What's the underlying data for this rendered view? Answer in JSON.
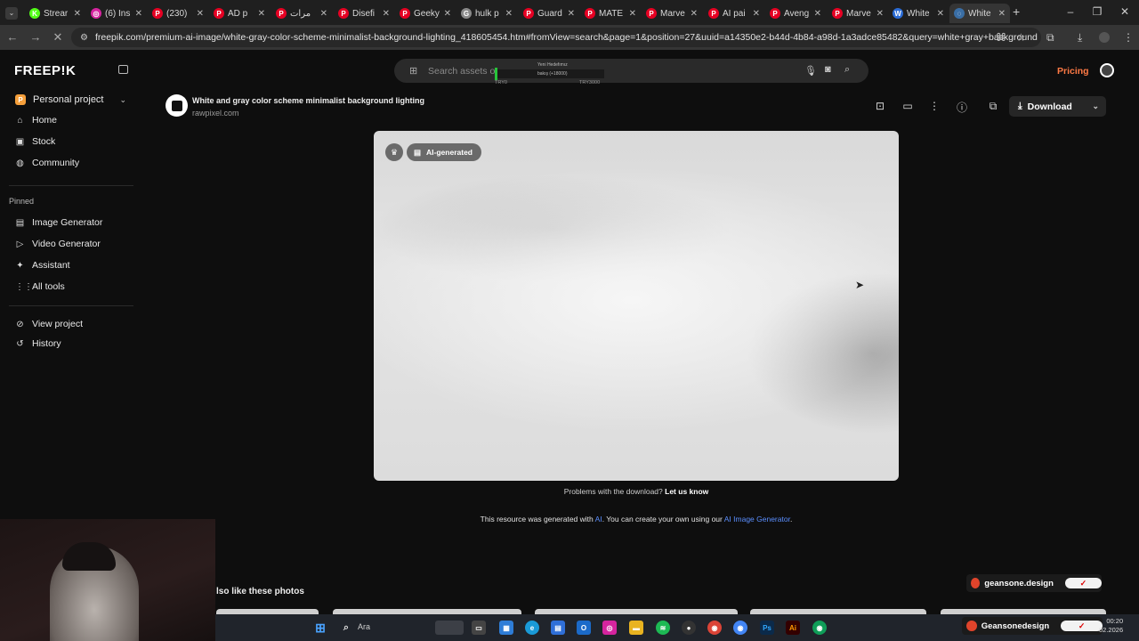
{
  "browser": {
    "tabs": [
      {
        "label": "Strear",
        "icon": "kick-icon",
        "color": "#53fc18",
        "glyph": "K"
      },
      {
        "label": "(6) Ins",
        "icon": "instagram-icon",
        "color": "#d6249f",
        "glyph": "◎"
      },
      {
        "label": "(230)",
        "icon": "pinterest-icon",
        "color": "#e60023",
        "glyph": "P"
      },
      {
        "label": "AD p",
        "icon": "pinterest-icon",
        "color": "#e60023",
        "glyph": "P"
      },
      {
        "label": "مرات",
        "icon": "pinterest-icon",
        "color": "#e60023",
        "glyph": "P"
      },
      {
        "label": "Disefi",
        "icon": "pinterest-icon",
        "color": "#e60023",
        "glyph": "P"
      },
      {
        "label": "Geeky",
        "icon": "pinterest-icon",
        "color": "#e60023",
        "glyph": "P"
      },
      {
        "label": "hulk p",
        "icon": "google-icon",
        "color": "#8a8a8a",
        "glyph": "G"
      },
      {
        "label": "Guard",
        "icon": "pinterest-icon",
        "color": "#e60023",
        "glyph": "P"
      },
      {
        "label": "MATE",
        "icon": "pinterest-icon",
        "color": "#e60023",
        "glyph": "P"
      },
      {
        "label": "Marve",
        "icon": "pinterest-icon",
        "color": "#e60023",
        "glyph": "P"
      },
      {
        "label": "AI pai",
        "icon": "pinterest-icon",
        "color": "#e60023",
        "glyph": "P"
      },
      {
        "label": "Aveng",
        "icon": "pinterest-icon",
        "color": "#e60023",
        "glyph": "P"
      },
      {
        "label": "Marve",
        "icon": "pinterest-icon",
        "color": "#e60023",
        "glyph": "P"
      },
      {
        "label": "White",
        "icon": "word-icon",
        "color": "#2b6cd6",
        "glyph": "W"
      },
      {
        "label": "White",
        "icon": "loading-icon",
        "color": "#3a6ea5",
        "glyph": "◌",
        "active": true
      }
    ],
    "new_tab": "+",
    "url": "freepik.com/premium-ai-image/white-gray-color-scheme-minimalist-background-lighting_418605454.htm#fromView=search&page=1&position=27&uuid=a14350e2-b44d-4b84-a98d-1a3adce85482&query=white+gray+background"
  },
  "header": {
    "logo": "FREEP!K",
    "search_placeholder": "Search assets o",
    "overlay_top": "Yeni Hedefımız",
    "overlay_mid": "bakış (+18000)",
    "overlay_left": "TRY0",
    "overlay_right": "TRY3000",
    "pricing": "Pricing"
  },
  "sidebar": {
    "project": {
      "badge": "P",
      "label": "Personal project"
    },
    "main_items": [
      {
        "label": "Home",
        "icon": "home-icon",
        "glyph": "⌂"
      },
      {
        "label": "Stock",
        "icon": "image-icon",
        "glyph": "▣"
      },
      {
        "label": "Community",
        "icon": "globe-icon",
        "glyph": "◍"
      }
    ],
    "pinned_label": "Pinned",
    "pinned_items": [
      {
        "label": "Image Generator",
        "icon": "image-generator-icon",
        "glyph": "▤"
      },
      {
        "label": "Video Generator",
        "icon": "video-generator-icon",
        "glyph": "▷"
      },
      {
        "label": "Assistant",
        "icon": "assistant-icon",
        "glyph": "✦"
      },
      {
        "label": "All tools",
        "icon": "grid-icon",
        "glyph": "⋮⋮"
      }
    ],
    "bottom_items": [
      {
        "label": "View project",
        "icon": "link-icon",
        "glyph": "⊘"
      },
      {
        "label": "History",
        "icon": "history-icon",
        "glyph": "↺"
      }
    ]
  },
  "asset": {
    "title": "White and gray color scheme minimalist background lighting",
    "source": "rawpixel.com",
    "download_label": "Download",
    "badge_ai": "AI-generated",
    "problems_text": "Problems with the download?",
    "problems_link": "Let us know",
    "generated_prefix": "This resource was generated with",
    "generated_ai": "AI",
    "generated_middle": ". You can create your own using our",
    "generated_link": "AI Image Generator",
    "generated_suffix": "."
  },
  "related": {
    "heading": "lso like these photos"
  },
  "stream": {
    "badge_top": "geansone.design",
    "badge_bottom": "Geansonedesign"
  },
  "taskbar": {
    "search_text": "Ara",
    "time": "00:20",
    "date": "02.2026"
  }
}
